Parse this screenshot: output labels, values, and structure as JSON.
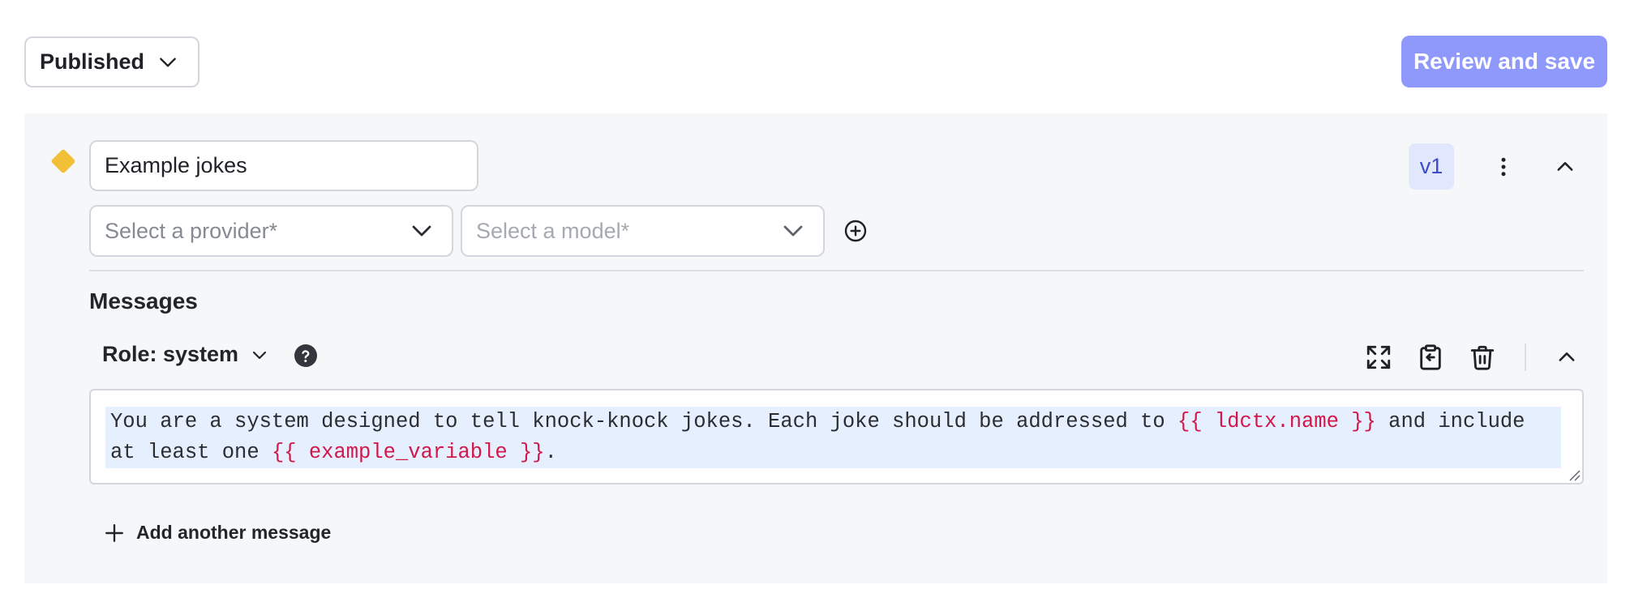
{
  "toolbar": {
    "status_label": "Published",
    "save_label": "Review and save"
  },
  "variation": {
    "name": "Example jokes",
    "version": "v1",
    "provider_placeholder": "Select a provider*",
    "model_placeholder": "Select a model*"
  },
  "messages": {
    "title": "Messages",
    "items": [
      {
        "role_label": "Role: system",
        "segments": [
          {
            "text": "You are a system designed to tell knock-knock jokes. Each joke should be addressed to ",
            "type": "text"
          },
          {
            "text": "{{ ldctx.name }}",
            "type": "variable"
          },
          {
            "text": " and include at least one ",
            "type": "text"
          },
          {
            "text": "{{ example_variable }}",
            "type": "variable"
          },
          {
            "text": ".",
            "type": "text"
          }
        ]
      }
    ],
    "add_label": "Add another message"
  },
  "colors": {
    "accent": "#8e99fb",
    "variable": "#d0184a",
    "badge_bg": "#e1e7fd",
    "badge_text": "#3d4bc4",
    "diamond": "#f2c037"
  },
  "icons": [
    "chevron-down-icon",
    "more-vertical-icon",
    "chevron-up-icon",
    "plus-circle-icon",
    "help-icon",
    "expand-icon",
    "copy-clipboard-icon",
    "trash-icon",
    "plus-icon"
  ]
}
